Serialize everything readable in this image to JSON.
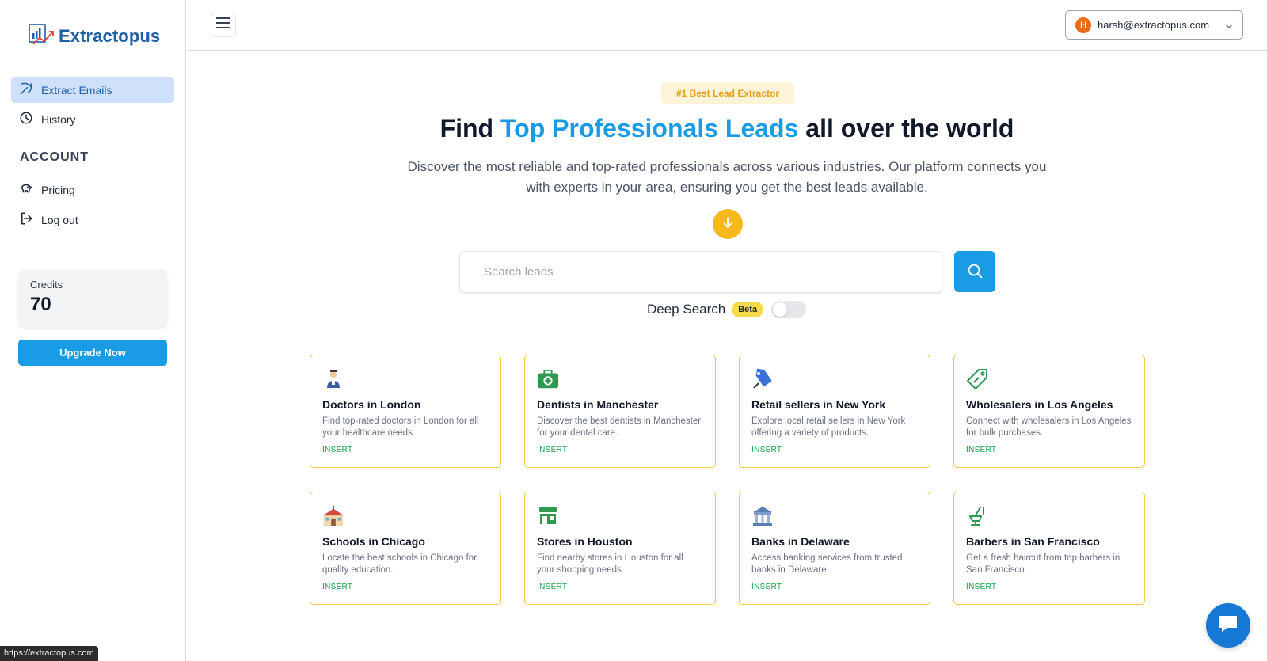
{
  "app": {
    "name": "Extractopus"
  },
  "sidebar": {
    "items": [
      {
        "label": "Extract Emails",
        "icon": "pickaxe-icon",
        "active": true
      },
      {
        "label": "History",
        "icon": "clock-icon",
        "active": false
      }
    ],
    "account_heading": "ACCOUNT",
    "account_items": [
      {
        "label": "Pricing",
        "icon": "piggy-bank-icon"
      },
      {
        "label": "Log out",
        "icon": "logout-icon"
      }
    ],
    "credits": {
      "label": "Credits",
      "value": "70"
    },
    "upgrade_label": "Upgrade Now"
  },
  "header": {
    "user": {
      "initial": "H",
      "email": "harsh@extractopus.com"
    }
  },
  "hero": {
    "badge": "#1 Best Lead Extractor",
    "headline_pre": "Find ",
    "headline_highlight": "Top Professionals Leads",
    "headline_post": " all over the world",
    "subtext": "Discover the most reliable and top-rated professionals across various industries. Our platform connects you with experts in your area, ensuring you get the best leads available."
  },
  "search": {
    "placeholder": "Search leads",
    "value": "",
    "deep_search_label": "Deep Search",
    "beta_label": "Beta",
    "deep_search_enabled": false
  },
  "cards": [
    {
      "title": "Doctors in London",
      "desc": "Find top-rated doctors in London for all your healthcare needs.",
      "action": "INSERT",
      "icon": "doctor-icon"
    },
    {
      "title": "Dentists in Manchester",
      "desc": "Discover the best dentists in Manchester for your dental care.",
      "action": "INSERT",
      "icon": "medical-kit-icon"
    },
    {
      "title": "Retail sellers in New York",
      "desc": "Explore local retail sellers in New York offering a variety of products.",
      "action": "INSERT",
      "icon": "price-tag-icon"
    },
    {
      "title": "Wholesalers in Los Angeles",
      "desc": "Connect with wholesalers in Los Angeles for bulk purchases.",
      "action": "INSERT",
      "icon": "discount-tag-icon"
    },
    {
      "title": "Schools in Chicago",
      "desc": "Locate the best schools in Chicago for quality education.",
      "action": "INSERT",
      "icon": "school-icon"
    },
    {
      "title": "Stores in Houston",
      "desc": "Find nearby stores in Houston for all your shopping needs.",
      "action": "INSERT",
      "icon": "store-icon"
    },
    {
      "title": "Banks in Delaware",
      "desc": "Access banking services from trusted banks in Delaware.",
      "action": "INSERT",
      "icon": "bank-icon"
    },
    {
      "title": "Barbers in San Francisco",
      "desc": "Get a fresh haircut from top barbers in San Francisco.",
      "action": "INSERT",
      "icon": "barber-chair-icon"
    }
  ],
  "status_bar": {
    "url": "https://extractopus.com"
  },
  "colors": {
    "accent": "#1a9be6",
    "brand": "#1e5fa8",
    "highlight": "#f5b91c",
    "card_border": "#f5c842",
    "action_green": "#16a34a"
  }
}
